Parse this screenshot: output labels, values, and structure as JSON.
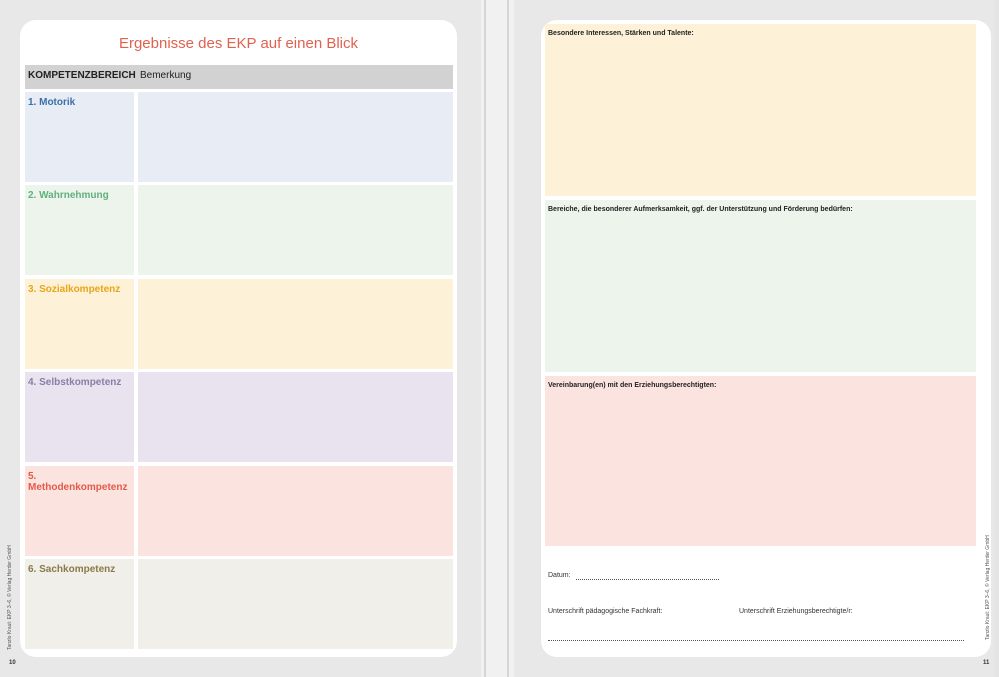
{
  "left_page": {
    "title": "Ergebnisse des EKP auf einen Blick",
    "columns": [
      "KOMPETENZBEREICH",
      "Bemerkung"
    ],
    "rows": [
      {
        "label": "1. Motorik",
        "color": "#3b6fa8"
      },
      {
        "label": "2. Wahrnehmung",
        "color": "#62b07e"
      },
      {
        "label": "3. Sozialkompetenz",
        "color": "#e8a51a"
      },
      {
        "label": "4. Selbstkompetenz",
        "color": "#8a7ea8"
      },
      {
        "label": "5. Methodenkompetenz",
        "color": "#e45a4a"
      },
      {
        "label": "6. Sachkompetenz",
        "color": "#8a7a4a"
      }
    ],
    "side_text": "Tanzlo Kraut: EKP 3–6, © Verlag Herder GmbH",
    "page_number": "10"
  },
  "right_page": {
    "sections": [
      "Besondere Interessen, Stärken und Talente:",
      "Bereiche, die besonderer Aufmerksamkeit, ggf. der Unterstützung und Förderung bedürfen:",
      "Vereinbarung(en) mit den Erziehungsberechtigten:"
    ],
    "date_label": "Datum:",
    "signature_staff": "Unterschrift pädagogische Fachkraft:",
    "signature_guardian": "Unterschrift Erziehungsberechtigte/r:",
    "side_text": "Tanzlo Kraut: EKP 3–6, © Verlag Herder GmbH",
    "page_number": "11"
  }
}
